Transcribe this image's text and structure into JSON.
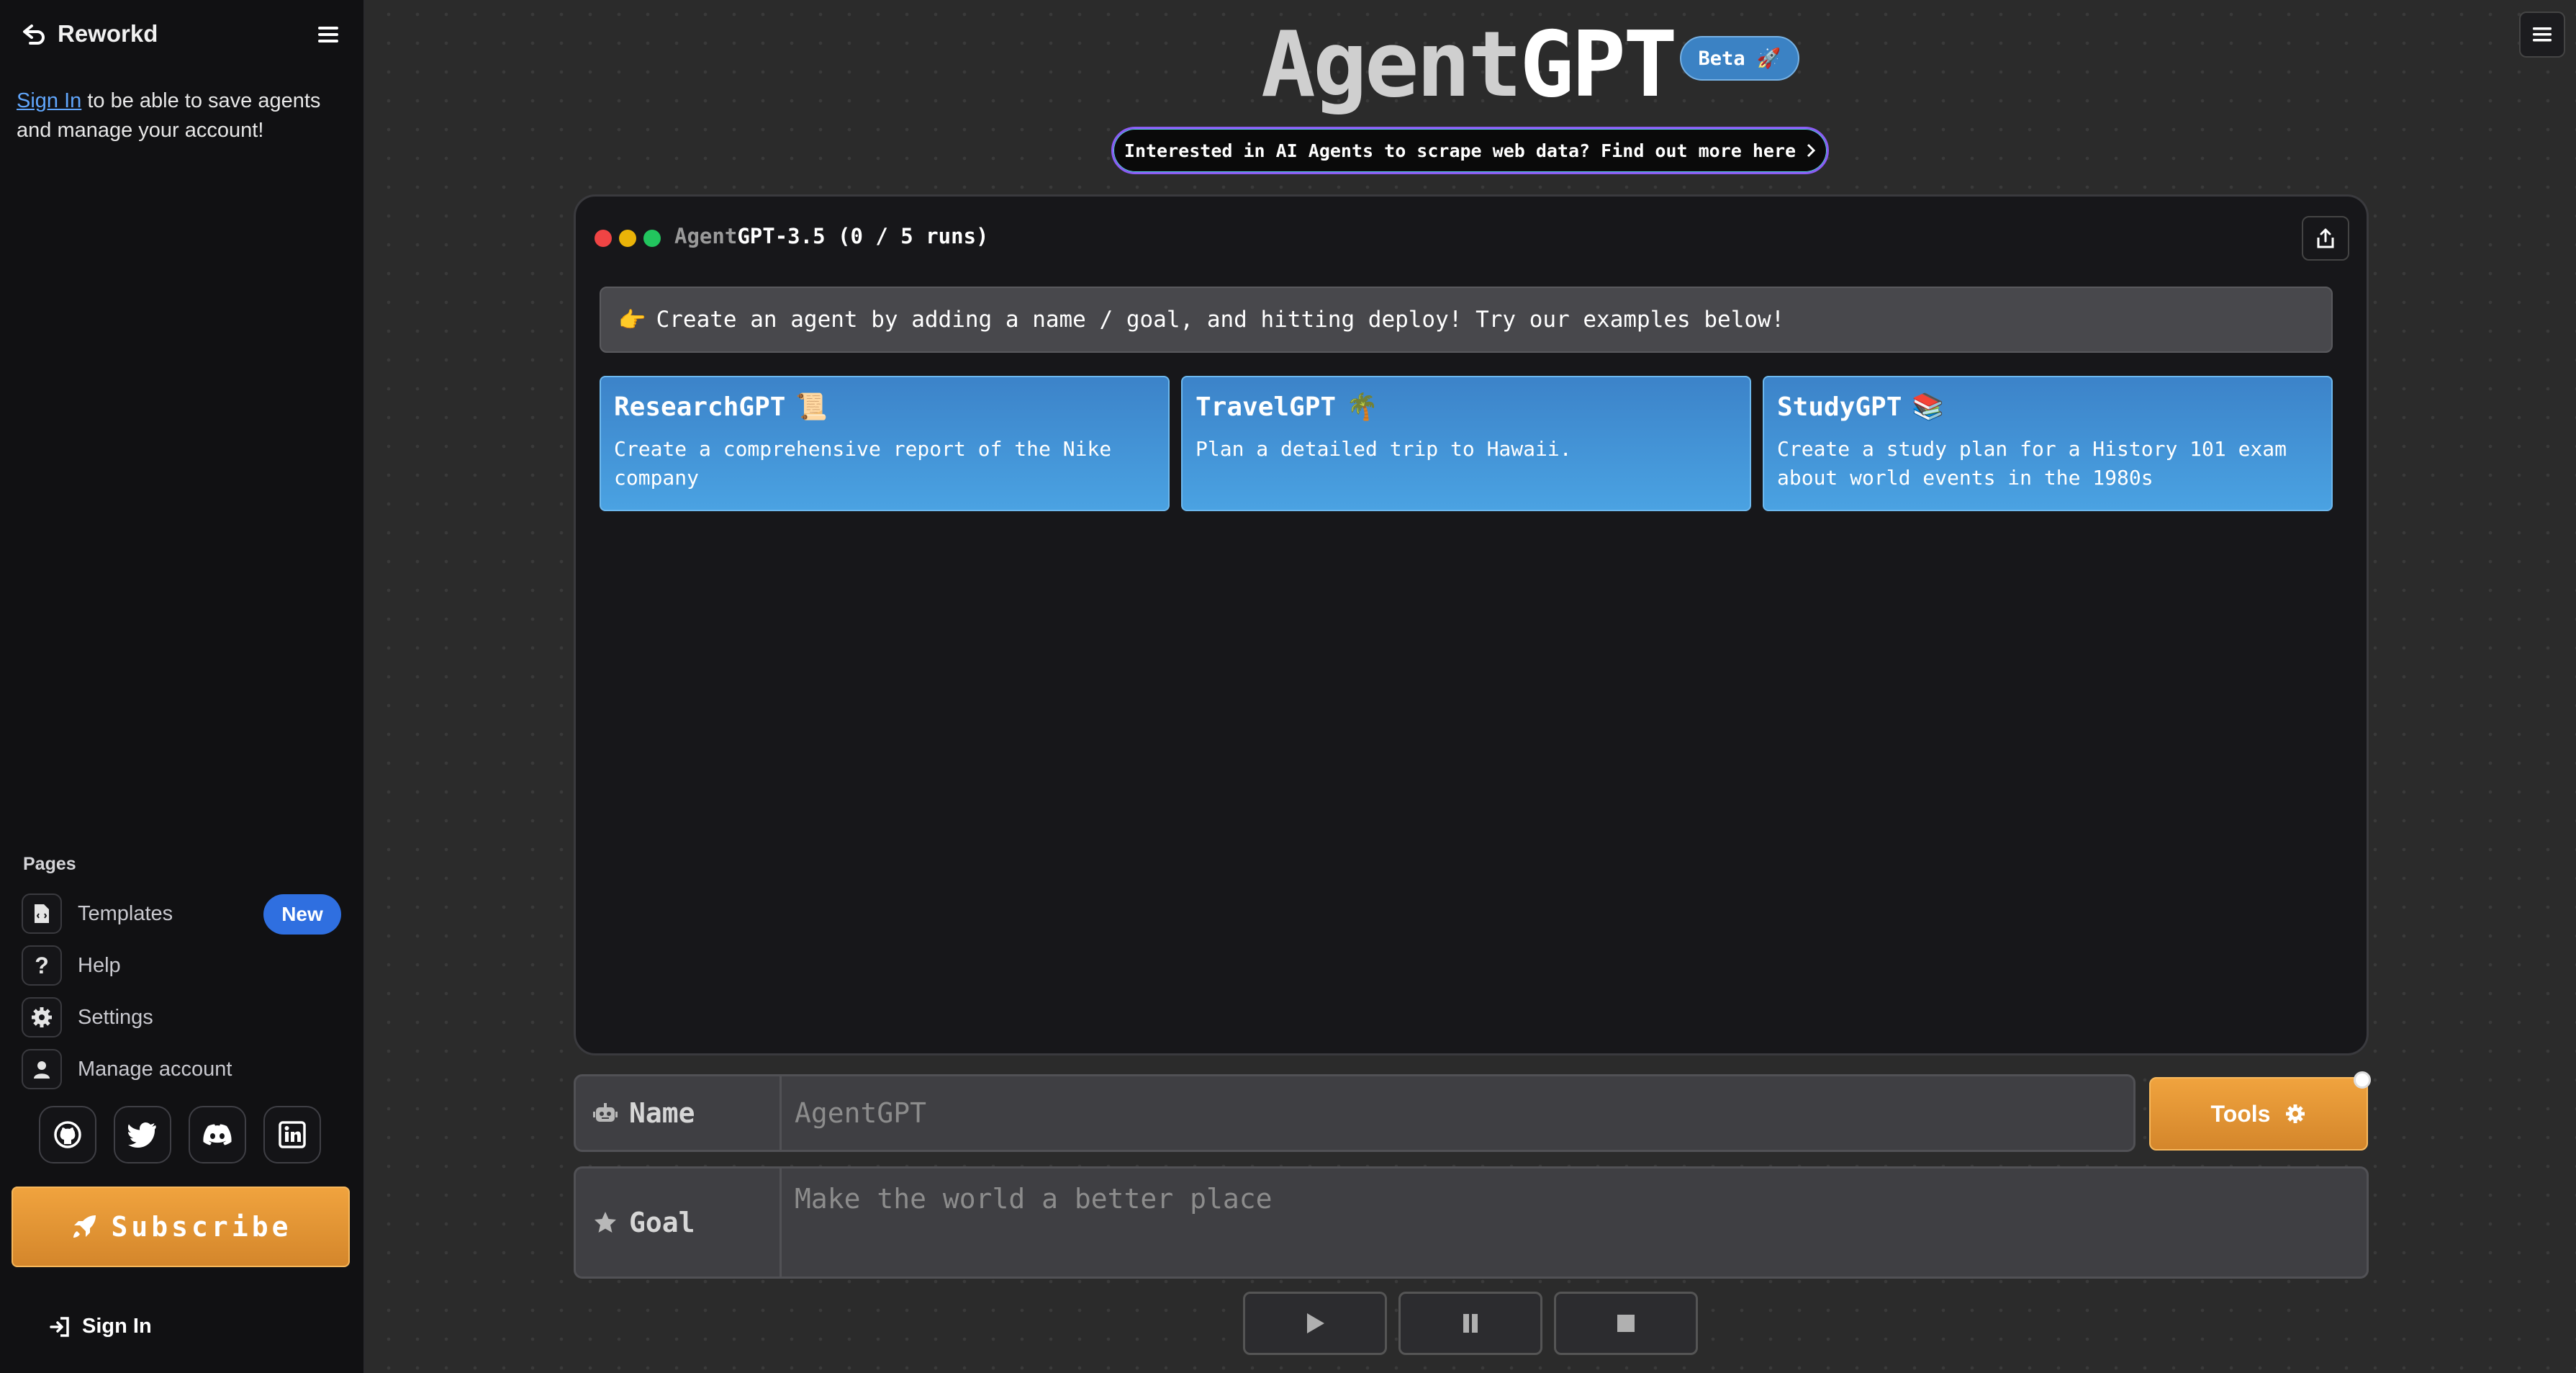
{
  "sidebar": {
    "brand": "Reworkd",
    "signin_link": "Sign In",
    "signin_note": " to be able to save agents and manage your account!",
    "pages_title": "Pages",
    "items": [
      {
        "label": "Templates",
        "badge": "New"
      },
      {
        "label": "Help"
      },
      {
        "label": "Settings"
      },
      {
        "label": "Manage account"
      }
    ],
    "socials": [
      "github-icon",
      "twitter-icon",
      "discord-icon",
      "linkedin-icon"
    ],
    "subscribe_label": "Subscribe",
    "signin_label": "Sign In"
  },
  "header": {
    "title_part1": "Agent",
    "title_part2": "GPT",
    "beta_label": "Beta 🚀",
    "promo_text": "Interested in AI Agents to scrape web data? Find out more here"
  },
  "window": {
    "model_prefix": "Agent",
    "model_rest": "GPT-3.5 (0 / 5 runs)",
    "hint_icon": "👉",
    "hint_text": "Create an agent by adding a name / goal, and hitting deploy! Try our examples below!",
    "cards": [
      {
        "title": "ResearchGPT",
        "emoji": "📜",
        "desc": "Create a comprehensive report of the Nike company"
      },
      {
        "title": "TravelGPT",
        "emoji": "🌴",
        "desc": "Plan a detailed trip to Hawaii."
      },
      {
        "title": "StudyGPT",
        "emoji": "📚",
        "desc": "Create a study plan for a History 101 exam about world events in the 1980s"
      }
    ]
  },
  "form": {
    "name_label": "Name",
    "name_placeholder": "AgentGPT",
    "goal_label": "Goal",
    "goal_placeholder": "Make the world a better place",
    "tools_label": "Tools"
  },
  "colors": {
    "accent_orange": "#e69433",
    "card_blue": "#4396d8",
    "badge_blue": "#2f6fe0"
  }
}
